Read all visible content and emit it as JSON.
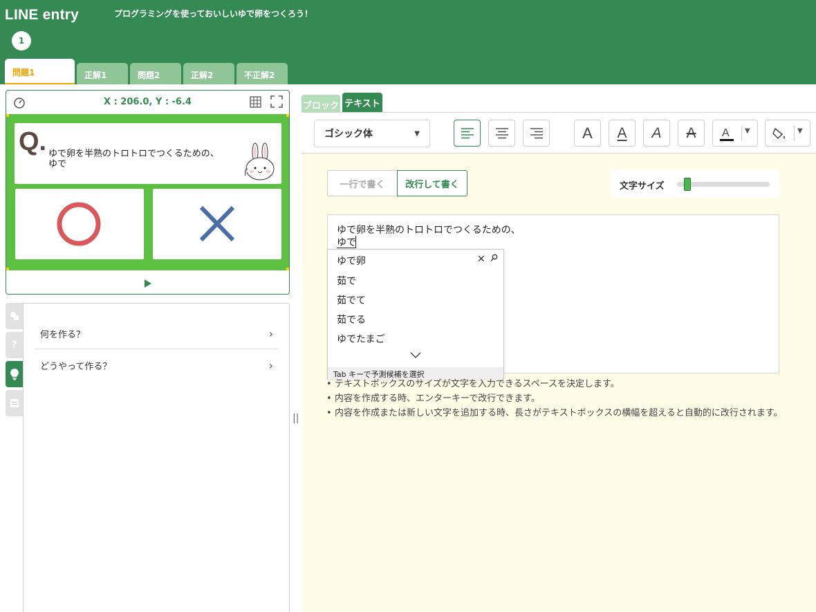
{
  "header": {
    "logo": "LINE entry",
    "project_title": "プログラミングを使っておいしいゆで卵をつくろう！",
    "step_number": "1",
    "colors": {
      "brand_green": "#358a54",
      "tab_inactive": "#8fc597",
      "tab_active_text": "#f0a400"
    }
  },
  "tabs": [
    {
      "label": "問題1",
      "active": true
    },
    {
      "label": "正解1",
      "active": false
    },
    {
      "label": "問題2",
      "active": false
    },
    {
      "label": "正解2",
      "active": false
    },
    {
      "label": "不正解2",
      "active": false
    }
  ],
  "stage": {
    "coordinates": "X : 206.0, Y : -6.4",
    "speed_icon": "speedometer-icon",
    "grid_icon": "grid-icon",
    "fullscreen_icon": "fullscreen-icon",
    "question_mark": "Q.",
    "question_text": "ゆで卵を半熟のトロトロでつくるための、\nゆで",
    "answer_o_icon": "circle-o-icon",
    "answer_x_icon": "cross-x-icon",
    "play_icon": "play-icon",
    "canvas_color": "#5cc142"
  },
  "side_tabs": [
    {
      "icon": "objects-icon",
      "active": false
    },
    {
      "icon": "question-icon",
      "active": false
    },
    {
      "icon": "lightbulb-icon",
      "active": true
    },
    {
      "icon": "pdf-icon",
      "active": false
    }
  ],
  "help_panel": {
    "items": [
      {
        "label": "何を作る？"
      },
      {
        "label": "どうやって作る？"
      }
    ]
  },
  "editor": {
    "mode_tabs": {
      "block": "ブロック",
      "text": "テキスト",
      "active": "text"
    },
    "font_select": {
      "value": "ゴシック体"
    },
    "toolbar_buttons": [
      "align-left-icon",
      "align-center-icon",
      "align-right-icon",
      "bold-icon",
      "underline-icon",
      "italic-icon",
      "strikethrough-icon",
      "text-color-icon",
      "fill-color-icon"
    ],
    "line_mode": {
      "single": "一行で書く",
      "multi": "改行して書く",
      "selected": "multi"
    },
    "font_size": {
      "label": "文字サイズ",
      "value_fraction": 0.05
    },
    "textbox": {
      "line1": "ゆで卵を半熟のトロトロでつくるための、",
      "line2": "ゆで"
    },
    "ime": {
      "candidates": [
        "ゆで卵",
        "茹で",
        "茹でて",
        "茹でる",
        "ゆでたまご"
      ],
      "footer": "Tab キーで予測候補を選択"
    },
    "notes": [
      "テキストボックスのサイズが文字を入力できるスペースを決定します。",
      "内容を作成する時、エンターキーで改行できます。",
      "内容を作成または新しい文字を追加する時、長さがテキストボックスの横幅を超えると自動的に改行されます。"
    ]
  }
}
